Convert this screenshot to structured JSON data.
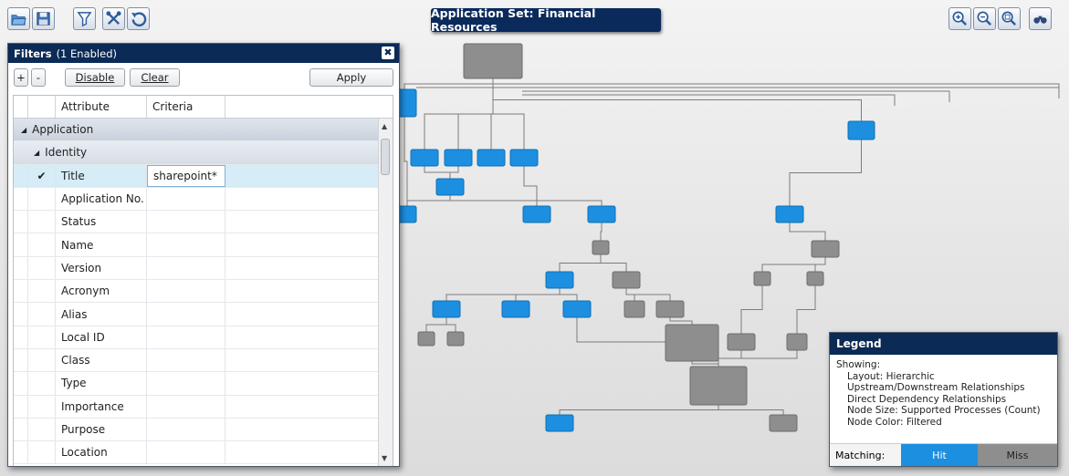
{
  "toolbar": {
    "icons": [
      "folder-open-icon",
      "save-icon",
      "filter-icon",
      "tools-icon",
      "undo-icon"
    ],
    "zoom_icons": [
      "zoom-in-icon",
      "zoom-out-icon",
      "zoom-fit-icon",
      "binoculars-icon"
    ]
  },
  "title": "Application Set: Financial Resources",
  "filters": {
    "title": "Filters",
    "enabled_note": "(1 Enabled)",
    "close_label": "✖",
    "buttons": {
      "add": "+",
      "remove": "-",
      "disable": "Disable",
      "clear": "Clear",
      "apply": "Apply"
    },
    "columns": {
      "attribute": "Attribute",
      "criteria": "Criteria"
    },
    "group_application": "Application",
    "group_identity": "Identity",
    "rows": [
      {
        "check": "✔",
        "attribute": "Title",
        "criteria": "sharepoint*",
        "selected": true
      },
      {
        "check": "",
        "attribute": "Application No.",
        "criteria": ""
      },
      {
        "check": "",
        "attribute": "Status",
        "criteria": ""
      },
      {
        "check": "",
        "attribute": "Name",
        "criteria": ""
      },
      {
        "check": "",
        "attribute": "Version",
        "criteria": ""
      },
      {
        "check": "",
        "attribute": "Acronym",
        "criteria": ""
      },
      {
        "check": "",
        "attribute": "Alias",
        "criteria": ""
      },
      {
        "check": "",
        "attribute": "Local ID",
        "criteria": ""
      },
      {
        "check": "",
        "attribute": "Class",
        "criteria": ""
      },
      {
        "check": "",
        "attribute": "Type",
        "criteria": ""
      },
      {
        "check": "",
        "attribute": "Importance",
        "criteria": ""
      },
      {
        "check": "",
        "attribute": "Purpose",
        "criteria": ""
      },
      {
        "check": "",
        "attribute": "Location",
        "criteria": ""
      }
    ]
  },
  "legend": {
    "title": "Legend",
    "showing": "Showing:",
    "lines": [
      "Layout: Hierarchic",
      "Upstream/Downstream Relationships",
      "Direct Dependency Relationships",
      "Node Size: Supported Processes (Count)",
      "Node Color: Filtered"
    ],
    "matching_label": "Matching:",
    "hit": "Hit",
    "miss": "Miss"
  },
  "colors": {
    "hit": "#1c8fe0",
    "miss": "#8e8e8e",
    "title_bar": "#0b2a55"
  }
}
